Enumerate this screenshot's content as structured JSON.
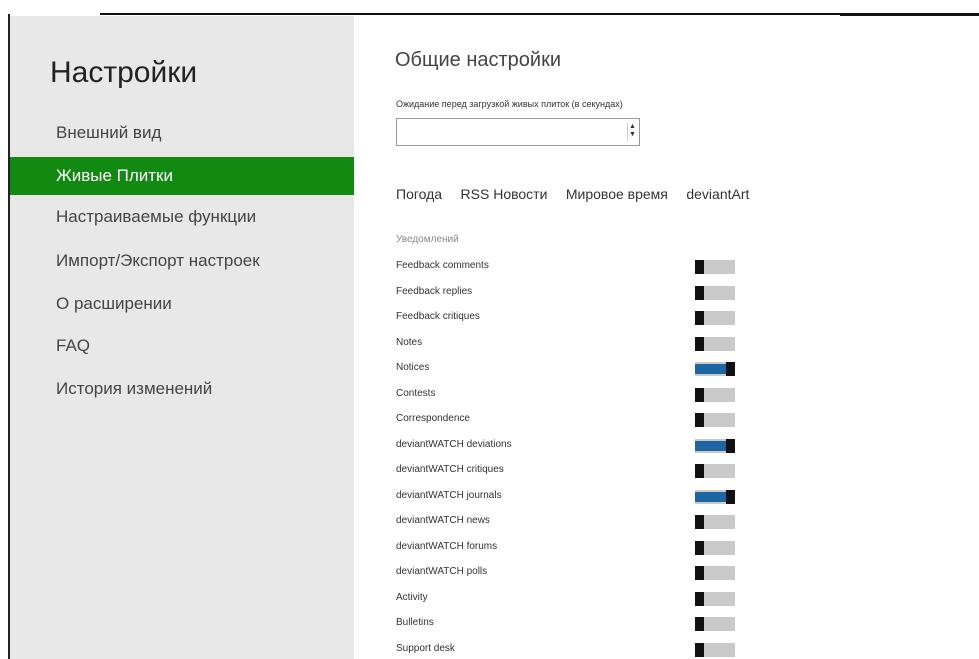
{
  "sidebar": {
    "title": "Настройки",
    "items": [
      {
        "label": "Внешний вид",
        "active": false
      },
      {
        "label": "Живые Плитки",
        "active": true
      },
      {
        "label": "Настраиваемые функции",
        "active": false
      },
      {
        "label": "Импорт/Экспорт настроек",
        "active": false
      },
      {
        "label": "О расширении",
        "active": false
      },
      {
        "label": "FAQ",
        "active": false
      },
      {
        "label": "История изменений",
        "active": false
      }
    ]
  },
  "main": {
    "title": "Общие настройки",
    "delay_label": "Ожидание перед загрузкой живых плиток (в секундах)",
    "delay_value": "",
    "tabs": [
      "Погода",
      "RSS Новости",
      "Мировое время",
      "deviantArt"
    ],
    "notifications_header": "Уведомлений",
    "notifications": [
      {
        "label": "Feedback comments",
        "on": false
      },
      {
        "label": "Feedback replies",
        "on": false
      },
      {
        "label": "Feedback critiques",
        "on": false
      },
      {
        "label": "Notes",
        "on": false
      },
      {
        "label": "Notices",
        "on": true
      },
      {
        "label": "Contests",
        "on": false
      },
      {
        "label": "Correspondence",
        "on": false
      },
      {
        "label": "deviantWATCH deviations",
        "on": true
      },
      {
        "label": "deviantWATCH critiques",
        "on": false
      },
      {
        "label": "deviantWATCH journals",
        "on": true
      },
      {
        "label": "deviantWATCH news",
        "on": false
      },
      {
        "label": "deviantWATCH forums",
        "on": false
      },
      {
        "label": "deviantWATCH polls",
        "on": false
      },
      {
        "label": "Activity",
        "on": false
      },
      {
        "label": "Bulletins",
        "on": false
      },
      {
        "label": "Support desk",
        "on": false
      }
    ]
  },
  "colors": {
    "accent": "#128a12",
    "toggle_on": "#1e66a3",
    "sidebar_bg": "#e8e8e8"
  }
}
